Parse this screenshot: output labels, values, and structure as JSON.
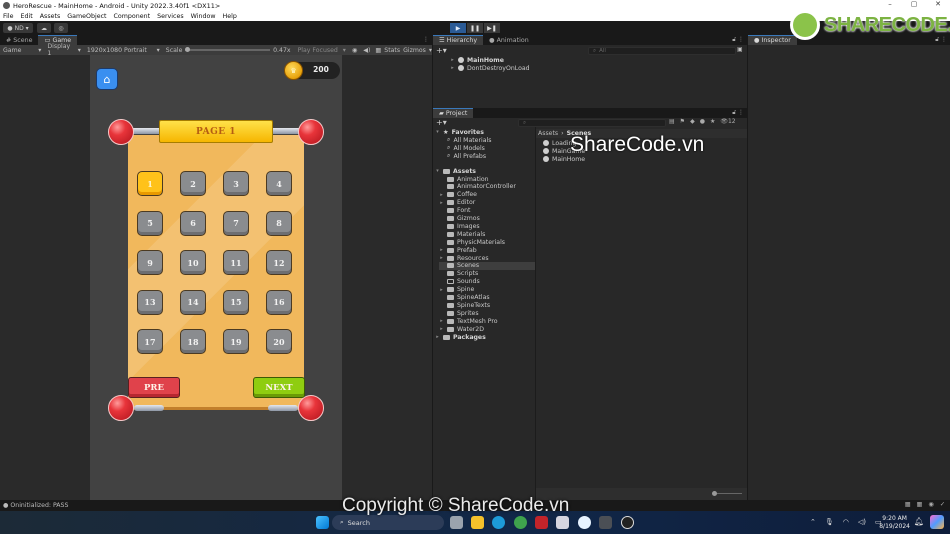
{
  "window": {
    "title": "HeroRescue - MainHome - Android - Unity 2022.3.40f1 <DX11>",
    "controls": [
      "–",
      "▢",
      "✕"
    ]
  },
  "menu": [
    "File",
    "Edit",
    "Assets",
    "GameObject",
    "Component",
    "Services",
    "Window",
    "Help"
  ],
  "toolbar": {
    "account": "ND ▾",
    "play_buttons": [
      "▶",
      "❚❚",
      "▶❚"
    ]
  },
  "game_view": {
    "tabs": [
      "# Scene",
      "Game"
    ],
    "display_mode": "Game",
    "display": "Display 1",
    "resolution": "1920x1080 Portrait",
    "scale_label": "Scale",
    "scale_value": "0.47x",
    "play_mode": "Play Focused",
    "stats": "Stats",
    "gizmos": "Gizmos"
  },
  "game": {
    "coins": "200",
    "page_title": "PAGE 1",
    "levels": [
      "1",
      "2",
      "3",
      "4",
      "5",
      "6",
      "7",
      "8",
      "9",
      "10",
      "11",
      "12",
      "13",
      "14",
      "15",
      "16",
      "17",
      "18",
      "19",
      "20"
    ],
    "current_level": "1",
    "pre_label": "PRE",
    "next_label": "NEXT"
  },
  "hierarchy": {
    "tabs": [
      "Hierarchy",
      "Animation"
    ],
    "search_placeholder": "All",
    "items": [
      {
        "label": "MainHome",
        "bold": true
      },
      {
        "label": "DontDestroyOnLoad",
        "bold": false
      }
    ]
  },
  "project": {
    "tab": "Project",
    "hidden_count": "12",
    "favorites_label": "Favorites",
    "favorites": [
      "All Materials",
      "All Models",
      "All Prefabs"
    ],
    "assets_label": "Assets",
    "folders": [
      {
        "label": "Animation",
        "expand": false
      },
      {
        "label": "AnimatorController",
        "expand": false
      },
      {
        "label": "Coffee",
        "expand": true
      },
      {
        "label": "Editor",
        "expand": true
      },
      {
        "label": "Font",
        "expand": false
      },
      {
        "label": "Gizmos",
        "expand": false
      },
      {
        "label": "Images",
        "expand": false
      },
      {
        "label": "Materials",
        "expand": false
      },
      {
        "label": "PhysicMaterials",
        "expand": false
      },
      {
        "label": "Prefab",
        "expand": true
      },
      {
        "label": "Resources",
        "expand": true
      },
      {
        "label": "Scenes",
        "expand": false,
        "selected": true
      },
      {
        "label": "Scripts",
        "expand": false
      },
      {
        "label": "Sounds",
        "expand": false,
        "empty": true
      },
      {
        "label": "Spine",
        "expand": true
      },
      {
        "label": "SpineAtlas",
        "expand": false
      },
      {
        "label": "SpineTexts",
        "expand": false
      },
      {
        "label": "Sprites",
        "expand": false
      },
      {
        "label": "TextMesh Pro",
        "expand": true
      },
      {
        "label": "Water2D",
        "expand": true
      }
    ],
    "packages_label": "Packages",
    "breadcrumb": [
      "Assets",
      "Scenes"
    ],
    "scenes": [
      "Loading",
      "MainGame",
      "MainHome"
    ]
  },
  "inspector": {
    "tab": "Inspector"
  },
  "status": {
    "message": "Oninitialized: PASS"
  },
  "taskbar": {
    "search_label": "Search",
    "time": "9:20 AM",
    "date": "8/19/2024"
  },
  "watermarks": {
    "logo": "SHARECODE.vn",
    "center": "ShareCode.vn",
    "copyright": "Copyright © ShareCode.vn"
  },
  "colors": {
    "accent": "#3a79bb",
    "board": "#f1b85c",
    "level_current": "#ffc21a",
    "level_locked": "#8a8c8f",
    "pre": "#e0424b",
    "next": "#8fcd10"
  }
}
